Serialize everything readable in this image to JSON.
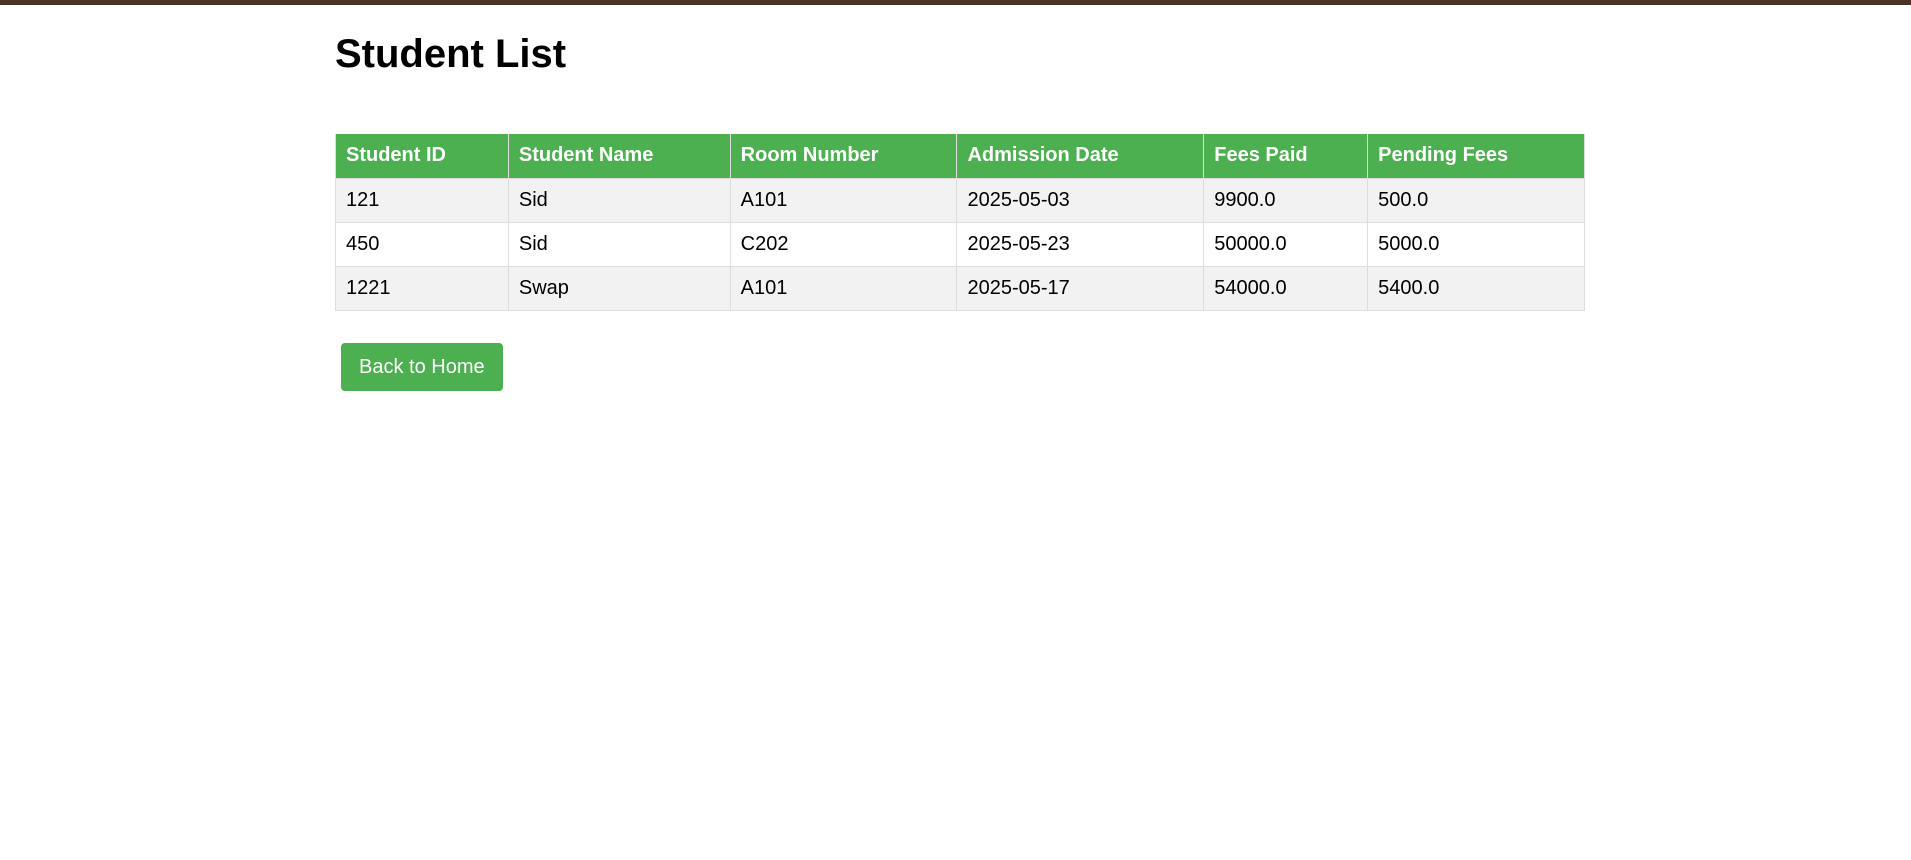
{
  "page": {
    "title": "Student List"
  },
  "table": {
    "headers": [
      "Student ID",
      "Student Name",
      "Room Number",
      "Admission Date",
      "Fees Paid",
      "Pending Fees"
    ],
    "rows": [
      [
        "121",
        "Sid",
        "A101",
        "2025-05-03",
        "9900.0",
        "500.0"
      ],
      [
        "450",
        "Sid",
        "C202",
        "2025-05-23",
        "50000.0",
        "5000.0"
      ],
      [
        "1221",
        "Swap",
        "A101",
        "2025-05-17",
        "54000.0",
        "5400.0"
      ]
    ]
  },
  "actions": {
    "back_label": "Back to Home"
  },
  "colors": {
    "accent": "#4caf50",
    "top_border": "#4a3324",
    "row_alt": "#f2f2f2"
  }
}
